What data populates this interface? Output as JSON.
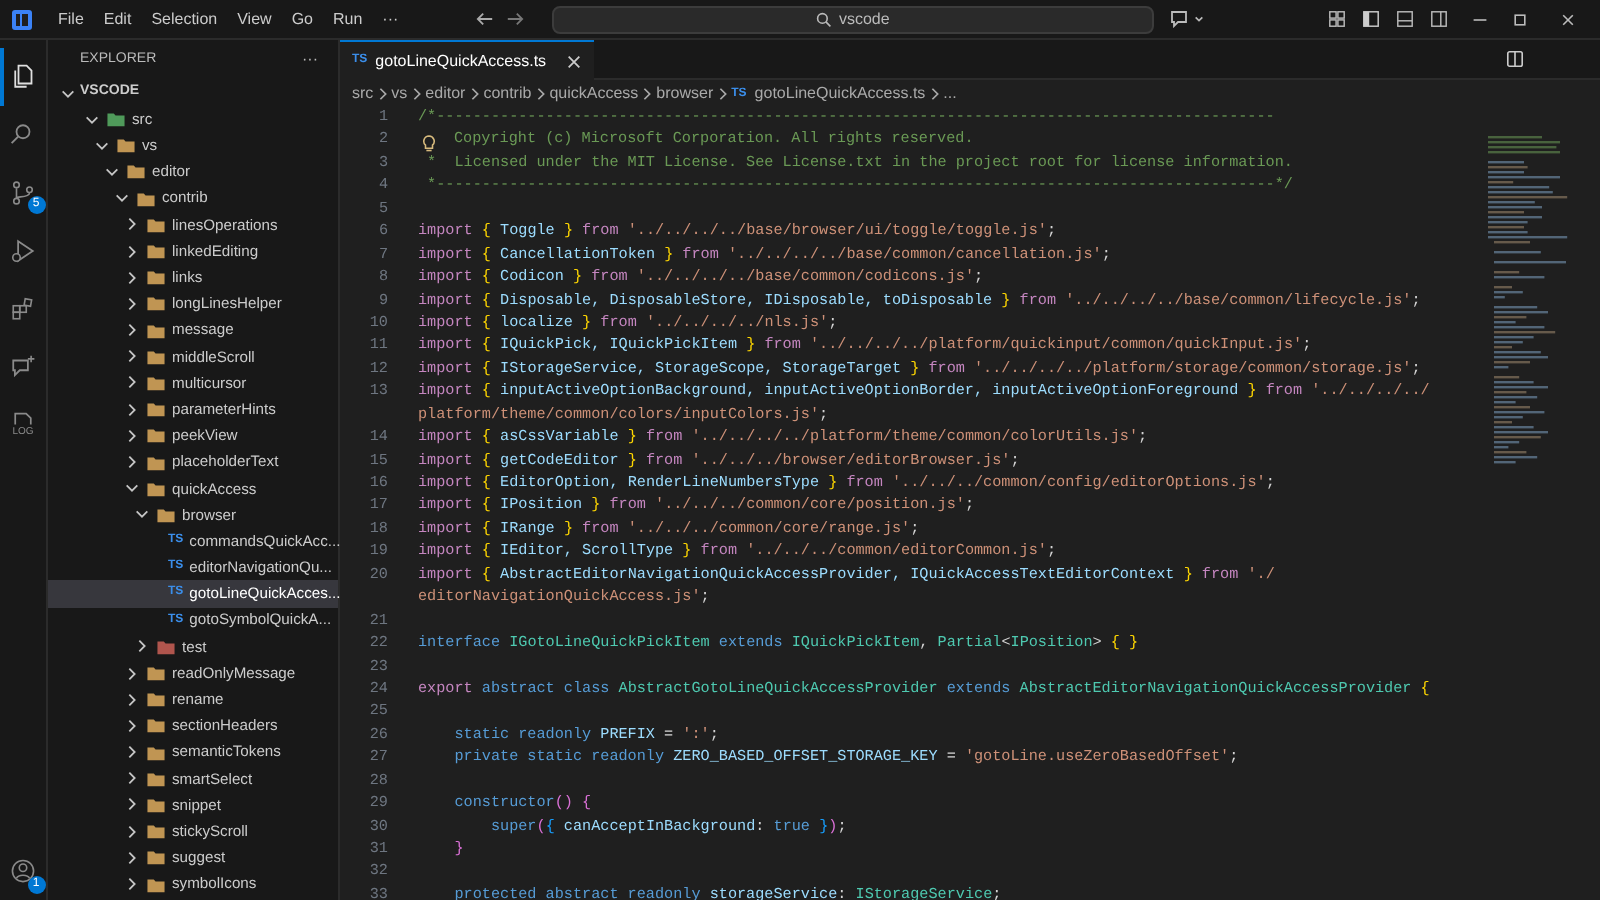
{
  "title_bar": {
    "menus": [
      "File",
      "Edit",
      "Selection",
      "View",
      "Go",
      "Run",
      "···"
    ],
    "search": {
      "value": "vscode"
    }
  },
  "activity_bar": {
    "items": [
      {
        "kind": "explorer",
        "selected": true
      },
      {
        "kind": "search",
        "selected": false
      },
      {
        "kind": "source-control",
        "selected": false,
        "badge": "5"
      },
      {
        "kind": "run-debug",
        "selected": false
      },
      {
        "kind": "extensions",
        "selected": false
      },
      {
        "kind": "chat",
        "selected": false
      },
      {
        "kind": "log",
        "selected": false,
        "label": "LOG"
      }
    ],
    "account": {
      "badge": "1"
    }
  },
  "sidebar": {
    "title": "EXPLORER",
    "more": "···",
    "section": {
      "label": "VSCODE",
      "expanded": true
    },
    "tree": [
      {
        "label": "src",
        "kind": "source-folder",
        "expanded": true,
        "selected": false,
        "children": [
          {
            "label": "vs",
            "kind": "folder",
            "expanded": true,
            "selected": false,
            "children": [
              {
                "label": "editor",
                "kind": "folder",
                "expanded": true,
                "selected": false,
                "children": [
                  {
                    "label": "contrib",
                    "kind": "folder",
                    "expanded": true,
                    "selected": false,
                    "children": [
                      {
                        "label": "linesOperations",
                        "kind": "folder",
                        "expanded": false,
                        "selected": false
                      },
                      {
                        "label": "linkedEditing",
                        "kind": "folder",
                        "expanded": false,
                        "selected": false
                      },
                      {
                        "label": "links",
                        "kind": "folder",
                        "expanded": false,
                        "selected": false
                      },
                      {
                        "label": "longLinesHelper",
                        "kind": "folder",
                        "expanded": false,
                        "selected": false
                      },
                      {
                        "label": "message",
                        "kind": "folder",
                        "expanded": false,
                        "selected": false
                      },
                      {
                        "label": "middleScroll",
                        "kind": "folder",
                        "expanded": false,
                        "selected": false
                      },
                      {
                        "label": "multicursor",
                        "kind": "folder",
                        "expanded": false,
                        "selected": false
                      },
                      {
                        "label": "parameterHints",
                        "kind": "folder",
                        "expanded": false,
                        "selected": false
                      },
                      {
                        "label": "peekView",
                        "kind": "folder",
                        "expanded": false,
                        "selected": false
                      },
                      {
                        "label": "placeholderText",
                        "kind": "folder",
                        "expanded": false,
                        "selected": false
                      },
                      {
                        "label": "quickAccess",
                        "kind": "folder",
                        "expanded": true,
                        "selected": false,
                        "children": [
                          {
                            "label": "browser",
                            "kind": "folder",
                            "expanded": true,
                            "selected": false,
                            "children": [
                              {
                                "label": "commandsQuickAcc...",
                                "kind": "ts-file",
                                "badge": "TS",
                                "selected": false
                              },
                              {
                                "label": "editorNavigationQu...",
                                "kind": "ts-file",
                                "badge": "TS",
                                "selected": false
                              },
                              {
                                "label": "gotoLineQuickAcces...",
                                "kind": "ts-file",
                                "badge": "TS",
                                "selected": true
                              },
                              {
                                "label": "gotoSymbolQuickA...",
                                "kind": "ts-file",
                                "badge": "TS",
                                "selected": false
                              }
                            ]
                          },
                          {
                            "label": "test",
                            "kind": "test-folder",
                            "expanded": false,
                            "selected": false
                          }
                        ]
                      },
                      {
                        "label": "readOnlyMessage",
                        "kind": "folder",
                        "expanded": false,
                        "selected": false
                      },
                      {
                        "label": "rename",
                        "kind": "folder",
                        "expanded": false,
                        "selected": false
                      },
                      {
                        "label": "sectionHeaders",
                        "kind": "folder",
                        "expanded": false,
                        "selected": false
                      },
                      {
                        "label": "semanticTokens",
                        "kind": "folder",
                        "expanded": false,
                        "selected": false
                      },
                      {
                        "label": "smartSelect",
                        "kind": "folder",
                        "expanded": false,
                        "selected": false
                      },
                      {
                        "label": "snippet",
                        "kind": "folder",
                        "expanded": false,
                        "selected": false
                      },
                      {
                        "label": "stickyScroll",
                        "kind": "folder",
                        "expanded": false,
                        "selected": false
                      },
                      {
                        "label": "suggest",
                        "kind": "folder",
                        "expanded": false,
                        "selected": false
                      },
                      {
                        "label": "symbolIcons",
                        "kind": "folder",
                        "expanded": false,
                        "selected": false
                      }
                    ]
                  }
                ]
              }
            ]
          }
        ]
      }
    ]
  },
  "editor": {
    "tabs": [
      {
        "badge": "TS",
        "label": "gotoLineQuickAccess.ts",
        "selected": true
      }
    ],
    "breadcrumb": [
      {
        "label": "src"
      },
      {
        "label": "vs"
      },
      {
        "label": "editor"
      },
      {
        "label": "contrib"
      },
      {
        "label": "quickAccess"
      },
      {
        "label": "browser"
      },
      {
        "badge": "TS",
        "label": "gotoLineQuickAccess.ts"
      },
      {
        "label": "..."
      }
    ],
    "lines": [
      {
        "n": "1",
        "tokens": [
          {
            "kind": "comment",
            "text": "/*--------------------------------------------------------------------------------------------"
          }
        ]
      },
      {
        "n": "2",
        "bulb": true,
        "tokens": [
          {
            "kind": "comment",
            "text": "Copyright (c) Microsoft Corporation. All rights reserved."
          }
        ]
      },
      {
        "n": "3",
        "tokens": [
          {
            "kind": "comment",
            "text": " *  Licensed under the MIT License. See License.txt in the project root for license information."
          }
        ]
      },
      {
        "n": "4",
        "tokens": [
          {
            "kind": "comment",
            "text": " *--------------------------------------------------------------------------------------------*/"
          }
        ]
      },
      {
        "n": "5"
      },
      {
        "n": "6",
        "tokens": [
          {
            "kind": "keyword",
            "text": "import "
          },
          {
            "kind": "brace",
            "text": "{"
          },
          {
            "kind": "variable",
            "text": " Toggle "
          },
          {
            "kind": "brace",
            "text": "}"
          },
          {
            "kind": "keyword",
            "text": " from "
          },
          {
            "kind": "string",
            "text": "'../../../../base/browser/ui/toggle/toggle.js'"
          },
          {
            "kind": "punct",
            "text": ";"
          }
        ]
      },
      {
        "n": "7",
        "tokens": [
          {
            "kind": "keyword",
            "text": "import "
          },
          {
            "kind": "brace",
            "text": "{"
          },
          {
            "kind": "variable",
            "text": " CancellationToken "
          },
          {
            "kind": "brace",
            "text": "}"
          },
          {
            "kind": "keyword",
            "text": " from "
          },
          {
            "kind": "string",
            "text": "'../../../../base/common/cancellation.js'"
          },
          {
            "kind": "punct",
            "text": ";"
          }
        ]
      },
      {
        "n": "8",
        "tokens": [
          {
            "kind": "keyword",
            "text": "import "
          },
          {
            "kind": "brace",
            "text": "{"
          },
          {
            "kind": "variable",
            "text": " Codicon "
          },
          {
            "kind": "brace",
            "text": "}"
          },
          {
            "kind": "keyword",
            "text": " from "
          },
          {
            "kind": "string",
            "text": "'../../../../base/common/codicons.js'"
          },
          {
            "kind": "punct",
            "text": ";"
          }
        ]
      },
      {
        "n": "9",
        "tokens": [
          {
            "kind": "keyword",
            "text": "import "
          },
          {
            "kind": "brace",
            "text": "{"
          },
          {
            "kind": "variable",
            "text": " Disposable, DisposableStore, IDisposable, toDisposable "
          },
          {
            "kind": "brace",
            "text": "}"
          },
          {
            "kind": "keyword",
            "text": " from "
          },
          {
            "kind": "string",
            "text": "'../../../../base/common/lifecycle.js'"
          },
          {
            "kind": "punct",
            "text": ";"
          }
        ]
      },
      {
        "n": "10",
        "tokens": [
          {
            "kind": "keyword",
            "text": "import "
          },
          {
            "kind": "brace",
            "text": "{"
          },
          {
            "kind": "variable",
            "text": " localize "
          },
          {
            "kind": "brace",
            "text": "}"
          },
          {
            "kind": "keyword",
            "text": " from "
          },
          {
            "kind": "string",
            "text": "'../../../../nls.js'"
          },
          {
            "kind": "punct",
            "text": ";"
          }
        ]
      },
      {
        "n": "11",
        "tokens": [
          {
            "kind": "keyword",
            "text": "import "
          },
          {
            "kind": "brace",
            "text": "{"
          },
          {
            "kind": "variable",
            "text": " IQuickPick, IQuickPickItem "
          },
          {
            "kind": "brace",
            "text": "}"
          },
          {
            "kind": "keyword",
            "text": " from "
          },
          {
            "kind": "string",
            "text": "'../../../../platform/quickinput/common/quickInput.js'"
          },
          {
            "kind": "punct",
            "text": ";"
          }
        ]
      },
      {
        "n": "12",
        "tokens": [
          {
            "kind": "keyword",
            "text": "import "
          },
          {
            "kind": "brace",
            "text": "{"
          },
          {
            "kind": "variable",
            "text": " IStorageService, StorageScope, StorageTarget "
          },
          {
            "kind": "brace",
            "text": "}"
          },
          {
            "kind": "keyword",
            "text": " from "
          },
          {
            "kind": "string",
            "text": "'../../../../platform/storage/common/storage.js'"
          },
          {
            "kind": "punct",
            "text": ";"
          }
        ]
      },
      {
        "n": "13",
        "tokens": [
          {
            "kind": "keyword",
            "text": "import "
          },
          {
            "kind": "brace",
            "text": "{"
          },
          {
            "kind": "variable",
            "text": " inputActiveOptionBackground, inputActiveOptionBorder, inputActiveOptionForeground "
          },
          {
            "kind": "brace",
            "text": "}"
          },
          {
            "kind": "keyword",
            "text": " from "
          },
          {
            "kind": "string",
            "text": "'../../../../"
          }
        ]
      },
      {
        "tokens": [
          {
            "kind": "string",
            "text": "platform/theme/common/colors/inputColors.js'"
          },
          {
            "kind": "punct",
            "text": ";"
          }
        ]
      },
      {
        "n": "14",
        "tokens": [
          {
            "kind": "keyword",
            "text": "import "
          },
          {
            "kind": "brace",
            "text": "{"
          },
          {
            "kind": "variable",
            "text": " asCssVariable "
          },
          {
            "kind": "brace",
            "text": "}"
          },
          {
            "kind": "keyword",
            "text": " from "
          },
          {
            "kind": "string",
            "text": "'../../../../platform/theme/common/colorUtils.js'"
          },
          {
            "kind": "punct",
            "text": ";"
          }
        ]
      },
      {
        "n": "15",
        "tokens": [
          {
            "kind": "keyword",
            "text": "import "
          },
          {
            "kind": "brace",
            "text": "{"
          },
          {
            "kind": "variable",
            "text": " getCodeEditor "
          },
          {
            "kind": "brace",
            "text": "}"
          },
          {
            "kind": "keyword",
            "text": " from "
          },
          {
            "kind": "string",
            "text": "'../../../browser/editorBrowser.js'"
          },
          {
            "kind": "punct",
            "text": ";"
          }
        ]
      },
      {
        "n": "16",
        "tokens": [
          {
            "kind": "keyword",
            "text": "import "
          },
          {
            "kind": "brace",
            "text": "{"
          },
          {
            "kind": "variable",
            "text": " EditorOption, RenderLineNumbersType "
          },
          {
            "kind": "brace",
            "text": "}"
          },
          {
            "kind": "keyword",
            "text": " from "
          },
          {
            "kind": "string",
            "text": "'../../../common/config/editorOptions.js'"
          },
          {
            "kind": "punct",
            "text": ";"
          }
        ]
      },
      {
        "n": "17",
        "tokens": [
          {
            "kind": "keyword",
            "text": "import "
          },
          {
            "kind": "brace",
            "text": "{"
          },
          {
            "kind": "variable",
            "text": " IPosition "
          },
          {
            "kind": "brace",
            "text": "}"
          },
          {
            "kind": "keyword",
            "text": " from "
          },
          {
            "kind": "string",
            "text": "'../../../common/core/position.js'"
          },
          {
            "kind": "punct",
            "text": ";"
          }
        ]
      },
      {
        "n": "18",
        "tokens": [
          {
            "kind": "keyword",
            "text": "import "
          },
          {
            "kind": "brace",
            "text": "{"
          },
          {
            "kind": "variable",
            "text": " IRange "
          },
          {
            "kind": "brace",
            "text": "}"
          },
          {
            "kind": "keyword",
            "text": " from "
          },
          {
            "kind": "string",
            "text": "'../../../common/core/range.js'"
          },
          {
            "kind": "punct",
            "text": ";"
          }
        ]
      },
      {
        "n": "19",
        "tokens": [
          {
            "kind": "keyword",
            "text": "import "
          },
          {
            "kind": "brace",
            "text": "{"
          },
          {
            "kind": "variable",
            "text": " IEditor, ScrollType "
          },
          {
            "kind": "brace",
            "text": "}"
          },
          {
            "kind": "keyword",
            "text": " from "
          },
          {
            "kind": "string",
            "text": "'../../../common/editorCommon.js'"
          },
          {
            "kind": "punct",
            "text": ";"
          }
        ]
      },
      {
        "n": "20",
        "tokens": [
          {
            "kind": "keyword",
            "text": "import "
          },
          {
            "kind": "brace",
            "text": "{"
          },
          {
            "kind": "variable",
            "text": " AbstractEditorNavigationQuickAccessProvider, IQuickAccessTextEditorContext "
          },
          {
            "kind": "brace",
            "text": "}"
          },
          {
            "kind": "keyword",
            "text": " from "
          },
          {
            "kind": "string",
            "text": "'./"
          }
        ]
      },
      {
        "tokens": [
          {
            "kind": "string",
            "text": "editorNavigationQuickAccess.js'"
          },
          {
            "kind": "punct",
            "text": ";"
          }
        ]
      },
      {
        "n": "21"
      },
      {
        "n": "22",
        "tokens": [
          {
            "kind": "storage",
            "text": "interface "
          },
          {
            "kind": "type",
            "text": "IGotoLineQuickPickItem"
          },
          {
            "kind": "storage",
            "text": " extends "
          },
          {
            "kind": "type",
            "text": "IQuickPickItem"
          },
          {
            "kind": "punct",
            "text": ", "
          },
          {
            "kind": "type",
            "text": "Partial"
          },
          {
            "kind": "punct",
            "text": "<"
          },
          {
            "kind": "type",
            "text": "IPosition"
          },
          {
            "kind": "punct",
            "text": ">"
          },
          {
            "kind": "brace",
            "text": " { }"
          }
        ]
      },
      {
        "n": "23"
      },
      {
        "n": "24",
        "tokens": [
          {
            "kind": "keyword",
            "text": "export "
          },
          {
            "kind": "storage",
            "text": "abstract class "
          },
          {
            "kind": "type",
            "text": "AbstractGotoLineQuickAccessProvider"
          },
          {
            "kind": "storage",
            "text": " extends "
          },
          {
            "kind": "type",
            "text": "AbstractEditorNavigationQuickAccessProvider"
          },
          {
            "kind": "brace",
            "text": " {"
          }
        ]
      },
      {
        "n": "25"
      },
      {
        "n": "26",
        "tokens": [
          {
            "kind": "storage",
            "text": "    static readonly "
          },
          {
            "kind": "variable",
            "text": "PREFIX"
          },
          {
            "kind": "punct",
            "text": " = "
          },
          {
            "kind": "string",
            "text": "':'"
          },
          {
            "kind": "punct",
            "text": ";"
          }
        ]
      },
      {
        "n": "27",
        "tokens": [
          {
            "kind": "storage",
            "text": "    private static readonly "
          },
          {
            "kind": "variable",
            "text": "ZERO_BASED_OFFSET_STORAGE_KEY"
          },
          {
            "kind": "punct",
            "text": " = "
          },
          {
            "kind": "string",
            "text": "'gotoLine.useZeroBasedOffset'"
          },
          {
            "kind": "punct",
            "text": ";"
          }
        ]
      },
      {
        "n": "28"
      },
      {
        "n": "29",
        "tokens": [
          {
            "kind": "storage",
            "text": "    constructor"
          },
          {
            "kind": "paren",
            "text": "() {"
          }
        ]
      },
      {
        "n": "30",
        "tokens": [
          {
            "kind": "storage",
            "text": "        super"
          },
          {
            "kind": "paren",
            "text": "("
          },
          {
            "kind": "brace2",
            "text": "{"
          },
          {
            "kind": "variable",
            "text": " canAcceptInBackground"
          },
          {
            "kind": "punct",
            "text": ": "
          },
          {
            "kind": "storage",
            "text": "true "
          },
          {
            "kind": "brace2",
            "text": "}"
          },
          {
            "kind": "paren",
            "text": ")"
          },
          {
            "kind": "punct",
            "text": ";"
          }
        ]
      },
      {
        "n": "31",
        "tokens": [
          {
            "kind": "paren",
            "text": "    }"
          }
        ]
      },
      {
        "n": "32"
      },
      {
        "n": "33",
        "tokens": [
          {
            "kind": "storage",
            "text": "    protected abstract readonly "
          },
          {
            "kind": "variable",
            "text": "storageService"
          },
          {
            "kind": "punct",
            "text": ": "
          },
          {
            "kind": "type",
            "text": "IStorageService"
          },
          {
            "kind": "punct",
            "text": ";"
          }
        ]
      }
    ]
  }
}
